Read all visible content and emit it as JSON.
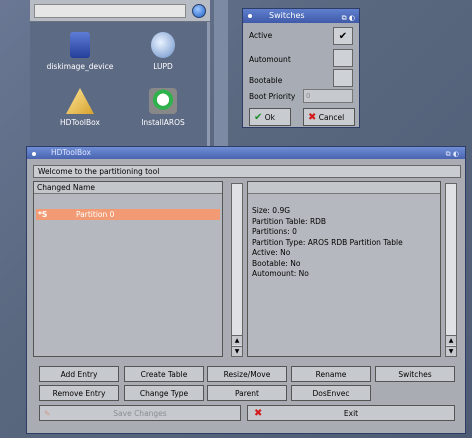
{
  "desktop": {
    "icons": [
      {
        "label": "diskimage_device",
        "icon": "disk-icon"
      },
      {
        "label": "LUPD",
        "icon": "network-icon"
      },
      {
        "label": "HDToolBox",
        "icon": "tools-icon"
      },
      {
        "label": "InstallAROS",
        "icon": "install-icon"
      }
    ]
  },
  "switches": {
    "title": "Switches",
    "rows": [
      {
        "label": "Active",
        "checked": true
      },
      {
        "label": "Automount",
        "checked": false
      },
      {
        "label": "Bootable",
        "checked": false
      }
    ],
    "boot_priority_label": "Boot Priority",
    "boot_priority_value": "0",
    "ok_label": "Ok",
    "cancel_label": "Cancel"
  },
  "hdtoolbox": {
    "title": "HDToolBox",
    "welcome": "Welcome to the partitioning tool",
    "list_header": "Changed Name",
    "list_rows": [
      {
        "changed": "*S",
        "name": "Partition 0"
      }
    ],
    "info_lines": [
      "Size: 0.9G",
      "Partition Table: RDB",
      "Partitions: 0",
      "Partition Type: AROS RDB Partition Table",
      "Active: No",
      "Bootable: No",
      "Automount: No"
    ],
    "buttons": {
      "add_entry": "Add Entry",
      "create_table": "Create Table",
      "resize_move": "Resize/Move",
      "rename": "Rename",
      "switches": "Switches",
      "remove_entry": "Remove Entry",
      "change_type": "Change Type",
      "parent": "Parent",
      "dosenvec": "DosEnvec",
      "save_changes": "Save Changes",
      "exit": "Exit"
    }
  },
  "colors": {
    "selection": "#f29a73",
    "titlebar": "#4a64b0",
    "window_bg": "#a9acb2"
  }
}
